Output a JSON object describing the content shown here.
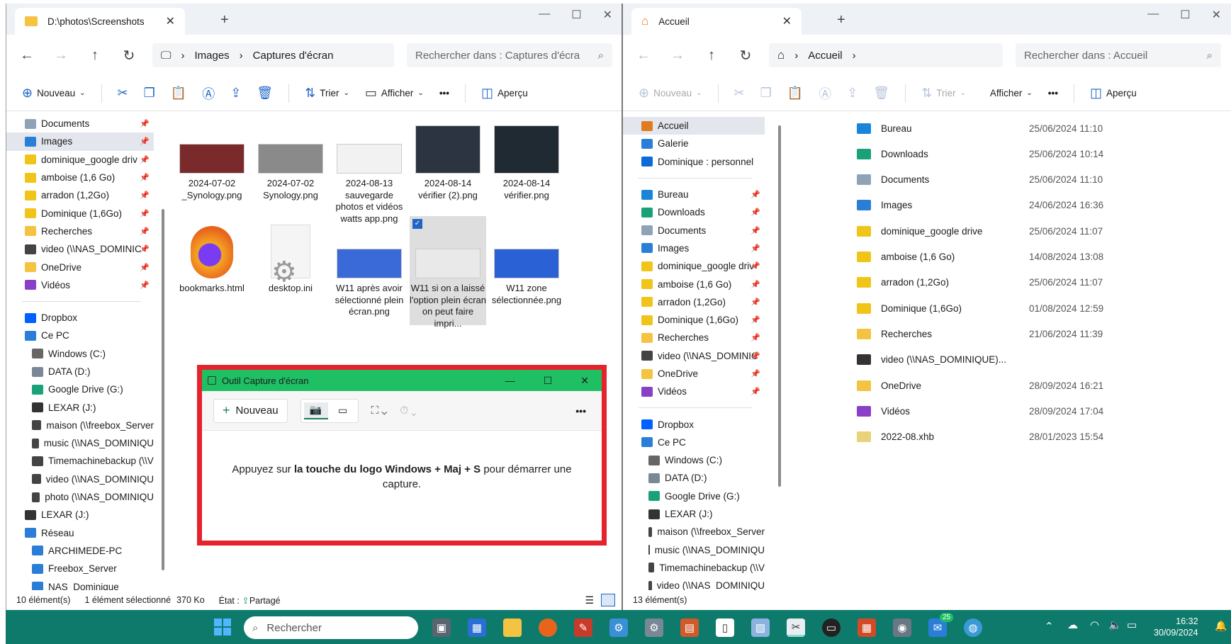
{
  "w1": {
    "tab_title": "D:\\photos\\Screenshots",
    "breadcrumb": [
      "Images",
      "Captures d'écran"
    ],
    "search_placeholder": "Rechercher dans : Captures d'écra",
    "cmd": {
      "new": "Nouveau",
      "sort": "Trier",
      "view": "Afficher",
      "more": "•••",
      "preview": "Aperçu"
    },
    "nav": [
      {
        "label": "Documents",
        "icon": "document-icon",
        "pin": true
      },
      {
        "label": "Images",
        "icon": "images-icon",
        "pin": true,
        "selected": true
      },
      {
        "label": "dominique_google driv",
        "icon": "gdrive-folder-icon",
        "pin": true
      },
      {
        "label": "amboise (1,6 Go)",
        "icon": "green-folder-icon",
        "pin": true
      },
      {
        "label": "arradon (1,2Go)",
        "icon": "green-folder-icon",
        "pin": true
      },
      {
        "label": "Dominique (1,6Go)",
        "icon": "green-folder-icon",
        "pin": true
      },
      {
        "label": "Recherches",
        "icon": "folder-icon",
        "pin": true
      },
      {
        "label": "video (\\\\NAS_DOMINIC",
        "icon": "network-drive-icon",
        "pin": true
      },
      {
        "label": "OneDrive",
        "icon": "folder-icon",
        "pin": true
      },
      {
        "label": "Vidéos",
        "icon": "videos-icon",
        "pin": true
      }
    ],
    "nav2": [
      {
        "label": "Dropbox",
        "icon": "dropbox-icon",
        "indent": 0
      },
      {
        "label": "Ce PC",
        "icon": "pc-icon",
        "indent": 0
      },
      {
        "label": "Windows (C:)",
        "icon": "windows-drive-icon",
        "indent": 1
      },
      {
        "label": "DATA (D:)",
        "icon": "drive-icon",
        "indent": 1
      },
      {
        "label": "Google Drive (G:)",
        "icon": "gdrive-icon",
        "indent": 1
      },
      {
        "label": "LEXAR (J:)",
        "icon": "usb-drive-icon",
        "indent": 1
      },
      {
        "label": "maison (\\\\freebox_Server",
        "icon": "network-drive-icon",
        "indent": 1
      },
      {
        "label": "music (\\\\NAS_DOMINIQU",
        "icon": "network-drive-icon",
        "indent": 1
      },
      {
        "label": "Timemachinebackup (\\\\V",
        "icon": "network-drive-icon",
        "indent": 1
      },
      {
        "label": "video (\\\\NAS_DOMINIQU",
        "icon": "network-drive-icon",
        "indent": 1
      },
      {
        "label": "photo (\\\\NAS_DOMINIQU",
        "icon": "network-drive-icon",
        "indent": 1
      },
      {
        "label": "LEXAR (J:)",
        "icon": "usb-drive-icon",
        "indent": 0
      },
      {
        "label": "Réseau",
        "icon": "network-icon",
        "indent": 0
      },
      {
        "label": "ARCHIMEDE-PC",
        "icon": "computer-icon",
        "indent": 1
      },
      {
        "label": "Freebox_Server",
        "icon": "computer-icon",
        "indent": 1
      },
      {
        "label": "NAS_Dominique",
        "icon": "computer-icon",
        "indent": 1
      }
    ],
    "files": [
      {
        "name": "2024-07-02 _Synology.png",
        "thumb": "#7a2a2a"
      },
      {
        "name": "2024-07-02 Synology.png",
        "thumb": "#8a8a8a"
      },
      {
        "name": "2024-08-13 sauvegarde photos et vidéos watts app.png",
        "thumb": "#f2f2f2"
      },
      {
        "name": "2024-08-14 vérifier (2).png",
        "thumb": "#2b3440"
      },
      {
        "name": "2024-08-14 vérifier.png",
        "thumb": "#1f2a33"
      },
      {
        "name": "bookmarks.html",
        "thumb": "firefox"
      },
      {
        "name": "desktop.ini",
        "thumb": "gear"
      },
      {
        "name": "W11 après avoir sélectionné plein écran.png",
        "thumb": "#3a6ad8"
      },
      {
        "name": "W11 si on a laissé l'option plein écran on peut faire impri...",
        "thumb": "#e9e9e9",
        "selected": true
      },
      {
        "name": "W11 zone sélectionnée.png",
        "thumb": "#2a61d4"
      }
    ],
    "status": {
      "count": "10 élément(s)",
      "selected": "1 élément sélectionné",
      "size": "370 Ko",
      "state_label": "État :",
      "state_value": "Partagé"
    }
  },
  "w2": {
    "tab_title": "Accueil",
    "breadcrumb": [
      "Accueil"
    ],
    "search_placeholder": "Rechercher dans : Accueil",
    "cmd": {
      "new": "Nouveau",
      "sort": "Trier",
      "view": "Afficher",
      "more": "•••",
      "preview": "Aperçu"
    },
    "nav": [
      {
        "label": "Accueil",
        "icon": "home-icon",
        "selected": true
      },
      {
        "label": "Galerie",
        "icon": "gallery-icon"
      },
      {
        "label": "Dominique : personnel",
        "icon": "onedrive-icon"
      }
    ],
    "nav1": [
      {
        "label": "Bureau",
        "icon": "desktop-icon",
        "pin": true
      },
      {
        "label": "Downloads",
        "icon": "download-icon",
        "pin": true
      },
      {
        "label": "Documents",
        "icon": "document-icon",
        "pin": true
      },
      {
        "label": "Images",
        "icon": "images-icon",
        "pin": true
      },
      {
        "label": "dominique_google driv",
        "icon": "gdrive-folder-icon",
        "pin": true
      },
      {
        "label": "amboise (1,6 Go)",
        "icon": "green-folder-icon",
        "pin": true
      },
      {
        "label": "arradon (1,2Go)",
        "icon": "green-folder-icon",
        "pin": true
      },
      {
        "label": "Dominique (1,6Go)",
        "icon": "green-folder-icon",
        "pin": true
      },
      {
        "label": "Recherches",
        "icon": "folder-icon",
        "pin": true
      },
      {
        "label": "video (\\\\NAS_DOMINIC",
        "icon": "network-drive-icon",
        "pin": true
      },
      {
        "label": "OneDrive",
        "icon": "folder-icon",
        "pin": true
      },
      {
        "label": "Vidéos",
        "icon": "videos-icon",
        "pin": true
      }
    ],
    "nav2": [
      {
        "label": "Dropbox",
        "icon": "dropbox-icon",
        "indent": 0
      },
      {
        "label": "Ce PC",
        "icon": "pc-icon",
        "indent": 0
      },
      {
        "label": "Windows (C:)",
        "icon": "windows-drive-icon",
        "indent": 1
      },
      {
        "label": "DATA (D:)",
        "icon": "drive-icon",
        "indent": 1
      },
      {
        "label": "Google Drive (G:)",
        "icon": "gdrive-icon",
        "indent": 1
      },
      {
        "label": "LEXAR (J:)",
        "icon": "usb-drive-icon",
        "indent": 1
      },
      {
        "label": "maison (\\\\freebox_Server",
        "icon": "network-drive-icon",
        "indent": 1
      },
      {
        "label": "music (\\\\NAS_DOMINIQU",
        "icon": "network-drive-icon",
        "indent": 1
      },
      {
        "label": "Timemachinebackup (\\\\V",
        "icon": "network-drive-icon",
        "indent": 1
      },
      {
        "label": "video (\\\\NAS_DOMINIQU",
        "icon": "network-drive-icon",
        "indent": 1
      }
    ],
    "list": [
      {
        "name": "Bureau",
        "date": "25/06/2024 11:10",
        "icon": "#1a84d8"
      },
      {
        "name": "Downloads",
        "date": "25/06/2024 10:14",
        "icon": "#1aa17a"
      },
      {
        "name": "Documents",
        "date": "25/06/2024 11:10",
        "icon": "#8fa3b8"
      },
      {
        "name": "Images",
        "date": "24/06/2024 16:36",
        "icon": "#2a7ed8"
      },
      {
        "name": "dominique_google drive",
        "date": "25/06/2024 11:07",
        "icon": "#f0c419"
      },
      {
        "name": "amboise (1,6 Go)",
        "date": "14/08/2024 13:08",
        "icon": "#f0c419"
      },
      {
        "name": "arradon (1,2Go)",
        "date": "25/06/2024 11:07",
        "icon": "#f0c419"
      },
      {
        "name": "Dominique (1,6Go)",
        "date": "01/08/2024 12:59",
        "icon": "#f0c419"
      },
      {
        "name": "Recherches",
        "date": "21/06/2024 11:39",
        "icon": "#f5c342"
      },
      {
        "name": "video (\\\\NAS_DOMINIQUE)...",
        "date": "",
        "icon": "#333333"
      },
      {
        "name": "OneDrive",
        "date": "28/09/2024 16:21",
        "icon": "#f5c342"
      },
      {
        "name": "Vidéos",
        "date": "28/09/2024 17:04",
        "icon": "#8a3fc8"
      },
      {
        "name": "2022-08.xhb",
        "date": "28/01/2023 15:54",
        "icon": "#e8d27a"
      }
    ],
    "status": {
      "count": "13 élément(s)"
    }
  },
  "capture": {
    "title": "Outil Capture d'écran",
    "new_label": "Nouveau",
    "msg_pre": "Appuyez sur ",
    "msg_bold1": "la touche du logo Windows + Maj + S",
    "msg_post": " pour démarrer une capture."
  },
  "taskbar": {
    "search": "Rechercher",
    "time": "16:32",
    "date": "30/09/2024",
    "badge": "25"
  },
  "colors": {
    "accent": "#0e7a6b",
    "capture_green": "#1fbf63",
    "capture_border": "#e4232d",
    "selection": "#e3e6ec"
  }
}
